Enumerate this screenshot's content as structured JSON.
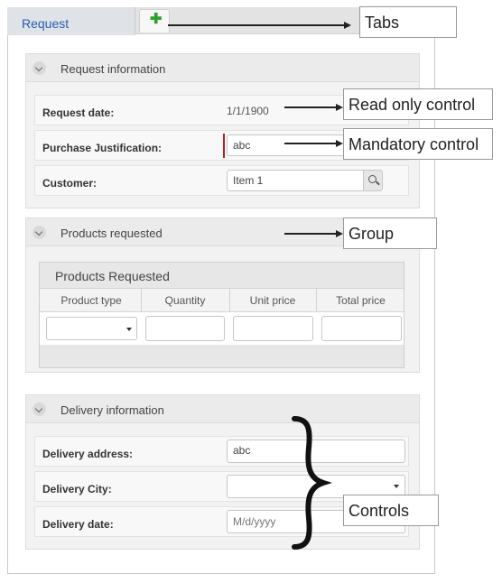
{
  "tabs": {
    "active_label": "Request",
    "add_symbol": "✚"
  },
  "sections": {
    "request_info": {
      "title": "Request information",
      "request_date_label": "Request date:",
      "request_date_value": "1/1/1900",
      "purchase_label": "Purchase Justification:",
      "purchase_value": "abc",
      "customer_label": "Customer:",
      "customer_value": "Item 1"
    },
    "products": {
      "title": "Products requested",
      "grid_title": "Products Requested",
      "columns": [
        "Product type",
        "Quantity",
        "Unit price",
        "Total price"
      ]
    },
    "delivery": {
      "title": "Delivery information",
      "address_label": "Delivery address:",
      "address_value": "abc",
      "city_label": "Delivery City:",
      "date_label": "Delivery date:",
      "date_placeholder": "M/d/yyyy"
    }
  },
  "callouts": {
    "tabs": "Tabs",
    "read_only": "Read only control",
    "mandatory": "Mandatory control",
    "group": "Group",
    "controls": "Controls"
  }
}
